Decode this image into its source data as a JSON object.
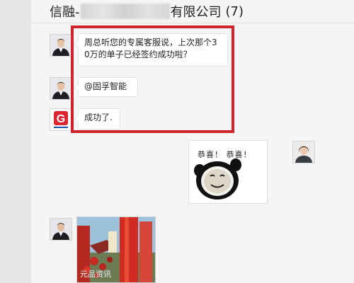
{
  "header": {
    "title_prefix": "信融-",
    "title_suffix": "有限公司",
    "member_count": "(7)"
  },
  "messages": [
    {
      "type": "text",
      "sender_avatar": "person-avatar",
      "text_line1": "周总听您的专属客服说，上次那个3",
      "text_line2": "0万的单子已经签约成功啦？"
    },
    {
      "type": "text",
      "sender_avatar": "person-avatar",
      "text": "@固孚智能"
    },
    {
      "type": "text",
      "sender_avatar": "company-logo-avatar",
      "logo_letter": "G",
      "text": "成功了."
    },
    {
      "type": "sticker",
      "sender_avatar": "person-avatar",
      "caption": "恭喜！ 恭喜！"
    },
    {
      "type": "image",
      "sender_avatar": "person-avatar"
    }
  ],
  "watermark": "元品资讯",
  "colors": {
    "highlight_border": "#d0232d",
    "logo_red": "#d9262f",
    "logo_blue": "#1f4fa3"
  }
}
